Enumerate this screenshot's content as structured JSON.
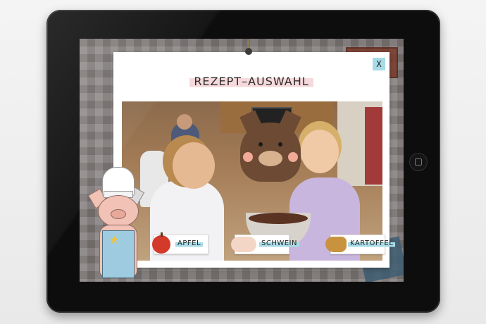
{
  "screen": {
    "title": "REZEPT–AUSWAHL",
    "close_label": "X",
    "choices": [
      {
        "label": "APFEL",
        "icon": "apple-icon"
      },
      {
        "label": "SCHWEIN",
        "icon": "pig-icon"
      },
      {
        "label": "KARTOFFEL",
        "icon": "potato-icon"
      }
    ]
  },
  "colors": {
    "accent_blue": "#a7dbe6",
    "title_highlight": "#f6d9dc",
    "tablet_frame": "#0d0d0d"
  }
}
